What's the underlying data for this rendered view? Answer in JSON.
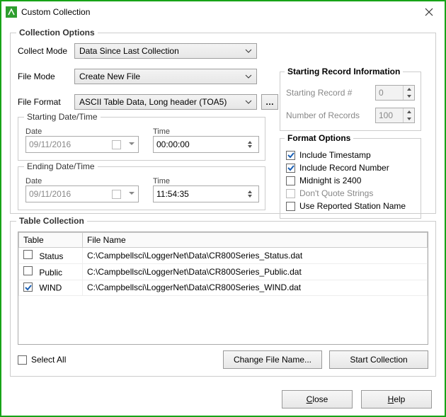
{
  "window": {
    "title": "Custom Collection"
  },
  "collection_options": {
    "legend": "Collection Options",
    "collect_mode": {
      "label": "Collect Mode",
      "value": "Data Since Last Collection"
    },
    "file_mode": {
      "label": "File Mode",
      "value": "Create New File"
    },
    "file_format": {
      "label": "File Format",
      "value": "ASCII Table Data, Long header (TOA5)"
    },
    "starting_dt": {
      "legend": "Starting Date/Time",
      "date_label": "Date",
      "time_label": "Time",
      "date_value": "09/11/2016",
      "time_value": "00:00:00"
    },
    "ending_dt": {
      "legend": "Ending Date/Time",
      "date_label": "Date",
      "time_label": "Time",
      "date_value": "09/11/2016",
      "time_value": "11:54:35"
    }
  },
  "starting_record": {
    "legend": "Starting Record Information",
    "starting_label": "Starting Record #",
    "starting_value": "0",
    "num_label": "Number of Records",
    "num_value": "100"
  },
  "format_options": {
    "legend": "Format Options",
    "include_timestamp": "Include Timestamp",
    "include_recno": "Include Record Number",
    "midnight": "Midnight is 2400",
    "dont_quote": "Don't Quote Strings",
    "use_reported": "Use Reported Station Name"
  },
  "table_collection": {
    "legend": "Table Collection",
    "col_table": "Table",
    "col_filename": "File Name",
    "rows": [
      {
        "name": "Status",
        "file": "C:\\Campbellsci\\LoggerNet\\Data\\CR800Series_Status.dat",
        "checked": false
      },
      {
        "name": "Public",
        "file": "C:\\Campbellsci\\LoggerNet\\Data\\CR800Series_Public.dat",
        "checked": false
      },
      {
        "name": "WIND",
        "file": "C:\\Campbellsci\\LoggerNet\\Data\\CR800Series_WIND.dat",
        "checked": true
      }
    ],
    "select_all": "Select All",
    "change_file": "Change File Name...",
    "start": "Start Collection"
  },
  "buttons": {
    "close": "lose",
    "close_ul": "C",
    "help": "elp",
    "help_ul": "H"
  }
}
